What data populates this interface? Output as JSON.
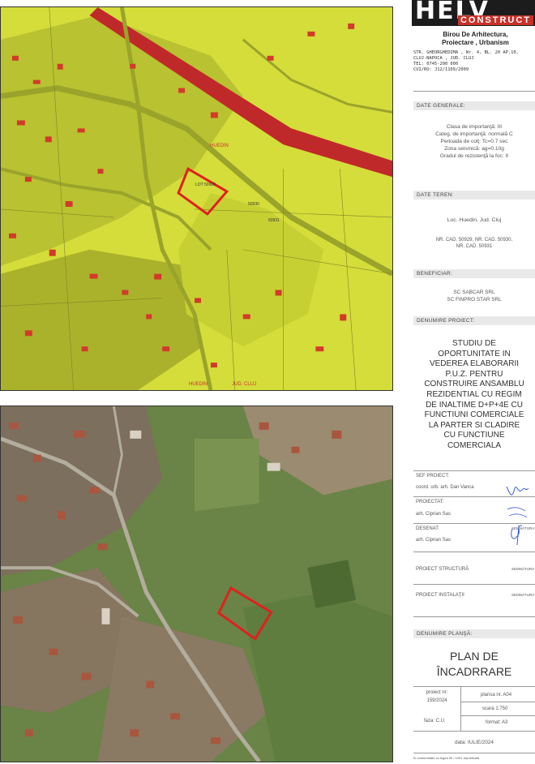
{
  "maps": {
    "cad_labels": [
      "HUEDIN",
      "LOT 50929",
      "50930",
      "50931"
    ],
    "bottom_labels": [
      "HUEDIN",
      "JUD. CLUJ"
    ]
  },
  "stamp": {
    "logo_word": "HELV",
    "logo_sub": "CONSTRUCT",
    "firm_line1": "Birou De Arhitectura,",
    "firm_line2": "Proiectare , Urbanism",
    "address": "STR. GHEORGHEDIMA , Nr. 4, BL. 20 AP.10,\nCLUJ-NAPOCA , JUD. CLUJ\nTEL: 0745-200 000\nCUI/RO: J12/1109/2009",
    "date_generale_hdr": "DATE GENERALE:",
    "date_generale_lines": [
      "Clasa de importanţă: III",
      "Categ. de importanţă: normală C",
      "Perioada de colţ: Tc=0.7 sec",
      "Zona seismică: ag=0.10g",
      "Gradul de rezistenţă la foc: II"
    ],
    "date_teren_hdr": "DATE TEREN:",
    "teren_loc": "Loc. Huedin, Jud. Cluj",
    "teren_cad1": "NR. CAD. 50929, NR. CAD. 50930,",
    "teren_cad2": "NR. CAD. 50931",
    "beneficiar_hdr": "BENEFICIAR:",
    "beneficiar1": "SC SABCAR SRL",
    "beneficiar2": "SC FINPRO STAR SRL",
    "denumire_hdr": "DENUMIRE PROIECT:",
    "proiect_lines": [
      "STUDIU DE",
      "OPORTUNITATE IN",
      "VEDEREA ELABORARII",
      "P.U.Z. PENTRU",
      "CONSTRUIRE ANSAMBLU",
      "REZIDENTIAL CU REGIM",
      "DE INALTIME D+P+4E CU",
      "FUNCTIUNI COMERCIALE",
      "LA PARTER SI CLADIRE",
      "CU FUNCTIUNE",
      "COMERCIALA"
    ],
    "sef_hdr": "SEF PROIECT:",
    "sef_name": "coord. urb. arh. Dan Vanca",
    "proiectat_hdr": "PROIECTAT:",
    "proiectat_name": "arh. Ciprian Sas",
    "desenat_hdr": "DESENAT:",
    "desenat_name": "arh. Ciprian Sas",
    "semnatura": "SEMNĂTURA",
    "structura": "PROIECT STRUCTURĂ",
    "instalatii": "PROIECT INSTALAŢII",
    "plansa_hdr": "DENUMIRE PLANŞĂ:",
    "plansa_title1": "PLAN DE",
    "plansa_title2": "ÎNCADRRARE",
    "proiect_nr_label": "proiect nr:",
    "proiect_nr": "159/2024",
    "plansa_nr": "plansa nr. A04",
    "scara": "scara 1:750",
    "faza": "faza: C.U.",
    "format": "format: A3",
    "data": "data: IULIE/2024",
    "footer": "În conformitate cu legea 50 / 1991 republicată"
  },
  "colors": {
    "highlight": "#e0211c",
    "cad_bg": "#d8e23a",
    "logo_accent": "#c8312a"
  }
}
